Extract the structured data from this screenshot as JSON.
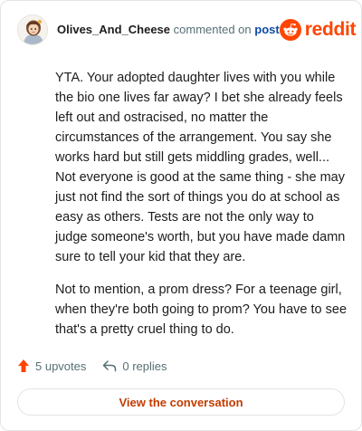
{
  "header": {
    "username": "Olives_And_Cheese",
    "action": "commented on",
    "post_link": "post",
    "brand_wordmark": "reddit"
  },
  "comment": {
    "paragraphs": [
      "YTA. Your adopted daughter lives with you while the bio one lives far away? I bet she already feels left out and ostracised, no matter the circumstances of the arrangement. You say she works hard but still gets middling grades, well... Not everyone is good at the same thing - she may just not find the sort of things you do at school as easy as others. Tests are not the only way to judge someone's worth, but you have made damn sure to tell your kid that they are.",
      "Not to mention, a prom dress? For a teenage girl, when they're both going to prom? You have to see that's a pretty cruel thing to do."
    ]
  },
  "footer": {
    "upvotes": "5 upvotes",
    "replies": "0 replies"
  },
  "cta": {
    "label": "View the conversation"
  },
  "colors": {
    "brand": "#ff4500",
    "link": "#0f4ba3",
    "cta_text": "#c43b00",
    "muted": "#576f76"
  },
  "icons": {
    "avatar": "user-avatar",
    "brand": "reddit-snoo-icon",
    "upvote": "upvote-arrow-icon",
    "reply": "reply-arrow-icon"
  }
}
